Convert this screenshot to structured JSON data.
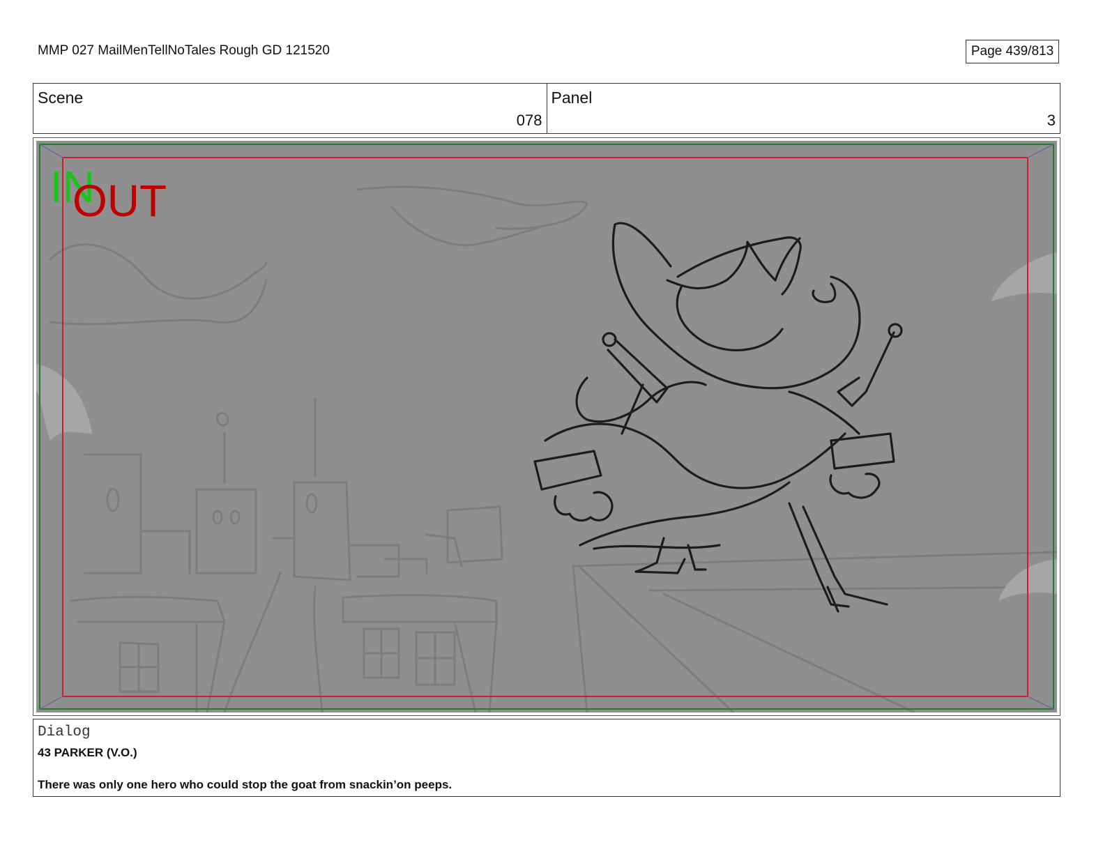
{
  "header": {
    "document_title": "MMP 027 MailMenTellNoTales Rough GD 121520",
    "page_label": "Page 439/813"
  },
  "info": {
    "scene_label": "Scene",
    "scene_value": "078",
    "panel_label": "Panel",
    "panel_value": "3"
  },
  "frame": {
    "in_marker": "IN",
    "out_marker": "OUT",
    "in_color": "#19c319",
    "out_color": "#c00000",
    "safe_frame_color": "#cc1f2a",
    "outer_frame_color": "#2a7a2a",
    "background_color": "#8f8f8f"
  },
  "dialog": {
    "heading": "Dialog",
    "speaker": "43 PARKER (V.O.)",
    "line": "There was only one hero who could stop the goat from snackin’on peeps."
  }
}
